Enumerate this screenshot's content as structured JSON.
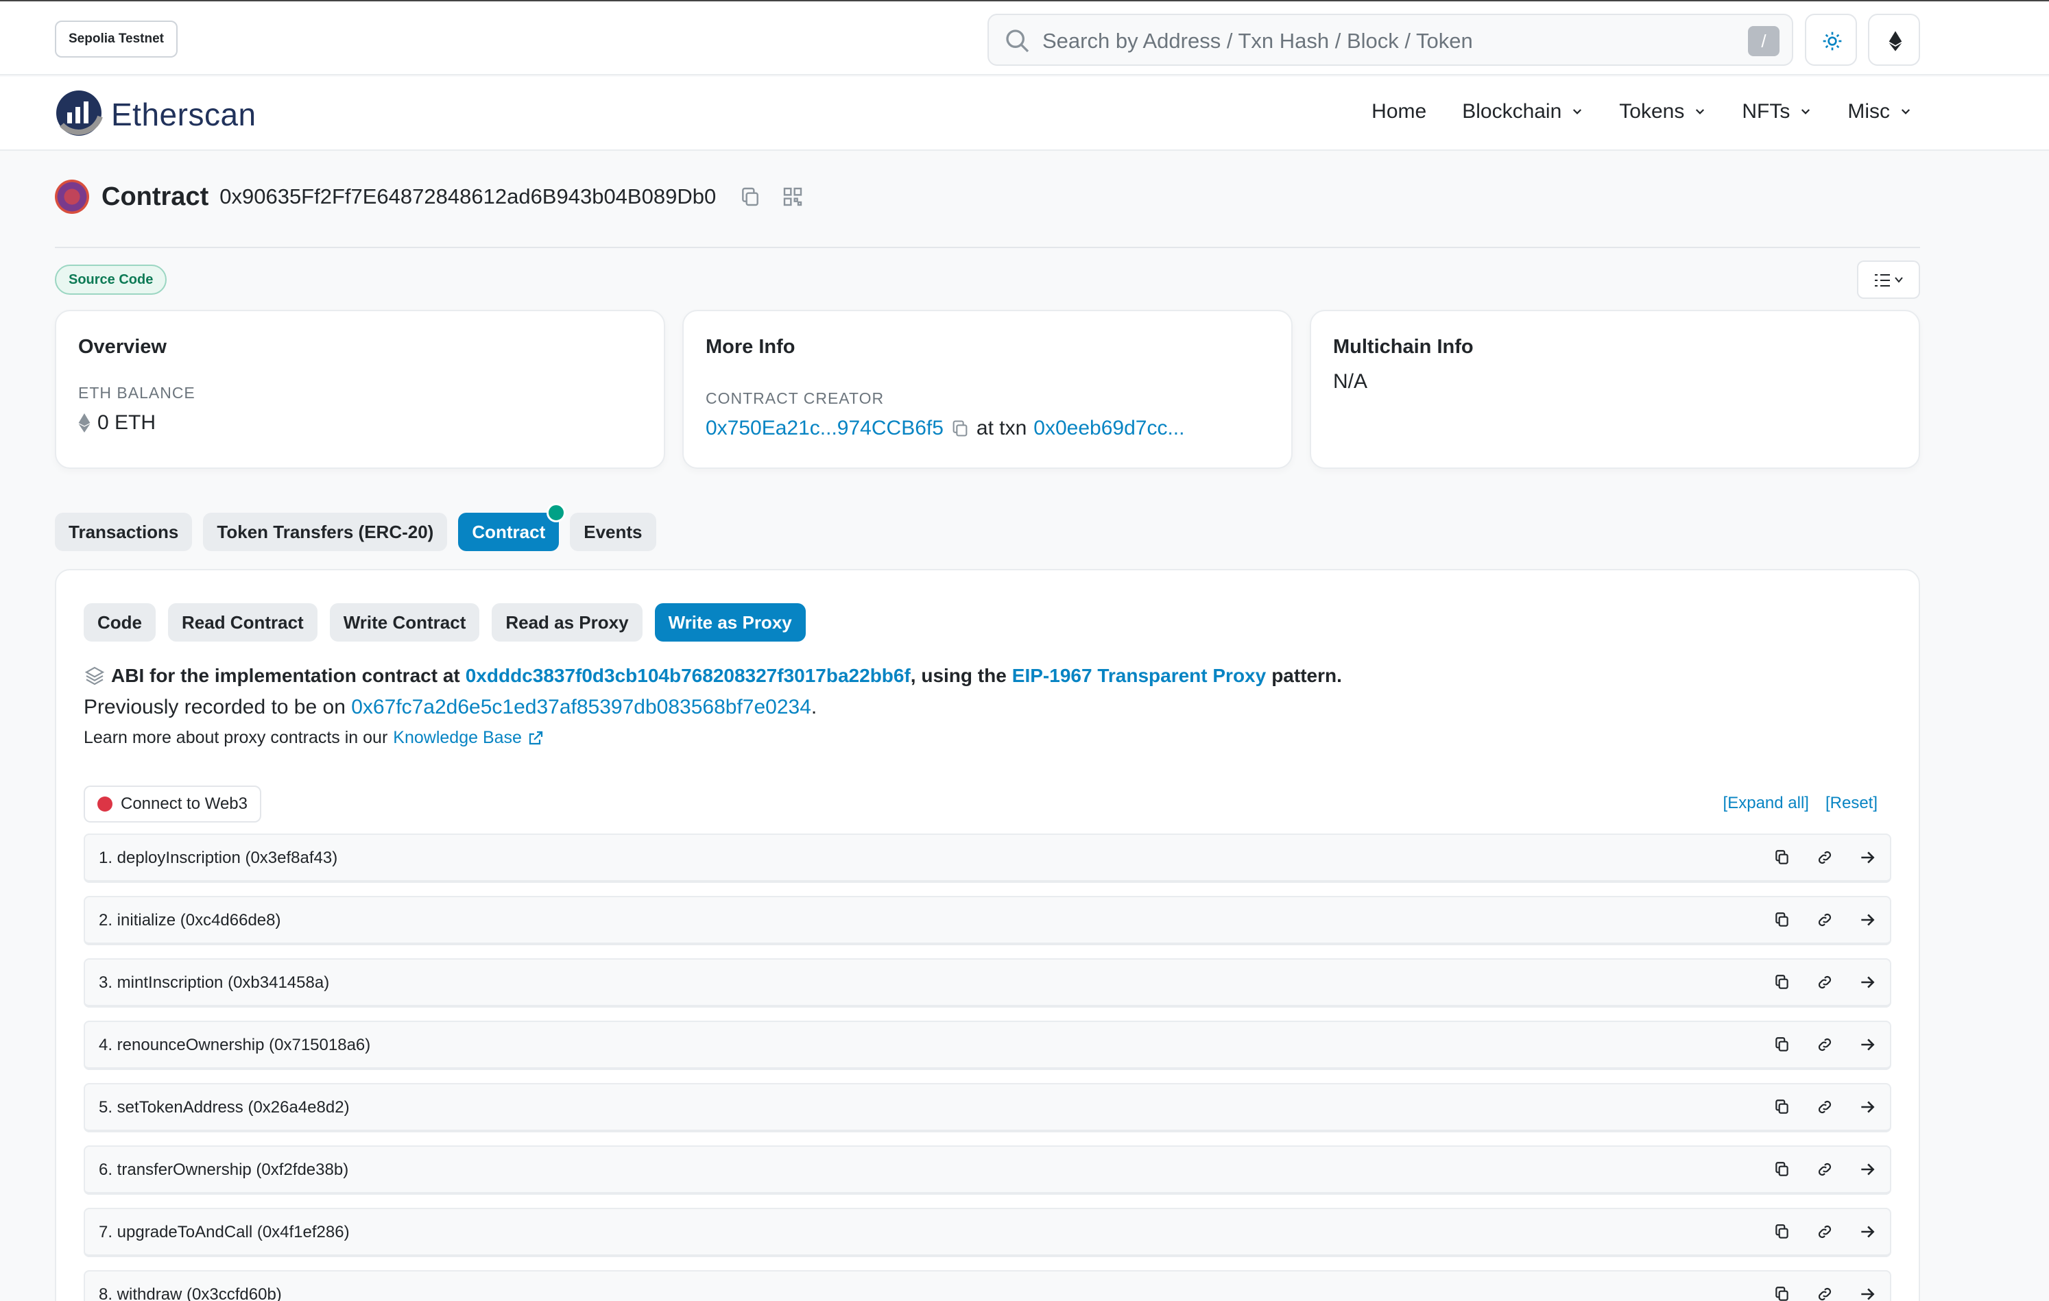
{
  "header": {
    "network_badge": "Sepolia Testnet",
    "search_placeholder": "Search by Address / Txn Hash / Block / Token",
    "search_shortcut": "/"
  },
  "nav": {
    "brand": "Etherscan",
    "items": [
      {
        "label": "Home"
      },
      {
        "label": "Blockchain"
      },
      {
        "label": "Tokens"
      },
      {
        "label": "NFTs"
      },
      {
        "label": "Misc"
      }
    ]
  },
  "page": {
    "title": "Contract",
    "address": "0x90635Ff2Ff7E64872848612ad6B943b04B089Db0",
    "source_badge": "Source Code"
  },
  "cards": {
    "overview": {
      "title": "Overview",
      "label": "ETH BALANCE",
      "value": "0 ETH"
    },
    "more_info": {
      "title": "More Info",
      "label": "CONTRACT CREATOR",
      "creator": "0x750Ea21c...974CCB6f5",
      "at_txn": "at txn",
      "txn": "0x0eeb69d7cc..."
    },
    "multichain": {
      "title": "Multichain Info",
      "value": "N/A"
    }
  },
  "tabs": [
    {
      "label": "Transactions"
    },
    {
      "label": "Token Transfers (ERC-20)"
    },
    {
      "label": "Contract"
    },
    {
      "label": "Events"
    }
  ],
  "subtabs": [
    {
      "label": "Code"
    },
    {
      "label": "Read Contract"
    },
    {
      "label": "Write Contract"
    },
    {
      "label": "Read as Proxy"
    },
    {
      "label": "Write as Proxy"
    }
  ],
  "proxy_info": {
    "abi_prefix": "ABI for the implementation contract at",
    "impl_address": "0xdddc3837f0d3cb104b768208327f3017ba22bb6f",
    "using_the": ", using the",
    "proxy_type": "EIP-1967 Transparent Proxy",
    "pattern": "pattern.",
    "prev_prefix": "Previously recorded to be on",
    "prev_address": "0x67fc7a2d6e5c1ed37af85397db083568bf7e0234",
    "prev_suffix": ".",
    "learn_prefix": "Learn more about proxy contracts in our",
    "learn_link": "Knowledge Base"
  },
  "web3": {
    "connect_label": "Connect to Web3",
    "expand_all": "[Expand all]",
    "reset": "[Reset]"
  },
  "functions": [
    {
      "label": "1. deployInscription (0x3ef8af43)"
    },
    {
      "label": "2. initialize (0xc4d66de8)"
    },
    {
      "label": "3. mintInscription (0xb341458a)"
    },
    {
      "label": "4. renounceOwnership (0x715018a6)"
    },
    {
      "label": "5. setTokenAddress (0x26a4e8d2)"
    },
    {
      "label": "6. transferOwnership (0xf2fde38b)"
    },
    {
      "label": "7. upgradeToAndCall (0x4f1ef286)"
    },
    {
      "label": "8. withdraw (0x3ccfd60b)"
    }
  ],
  "colors": {
    "accent": "#0784c3",
    "verified": "#00a186",
    "disconnected": "#dc3545"
  }
}
